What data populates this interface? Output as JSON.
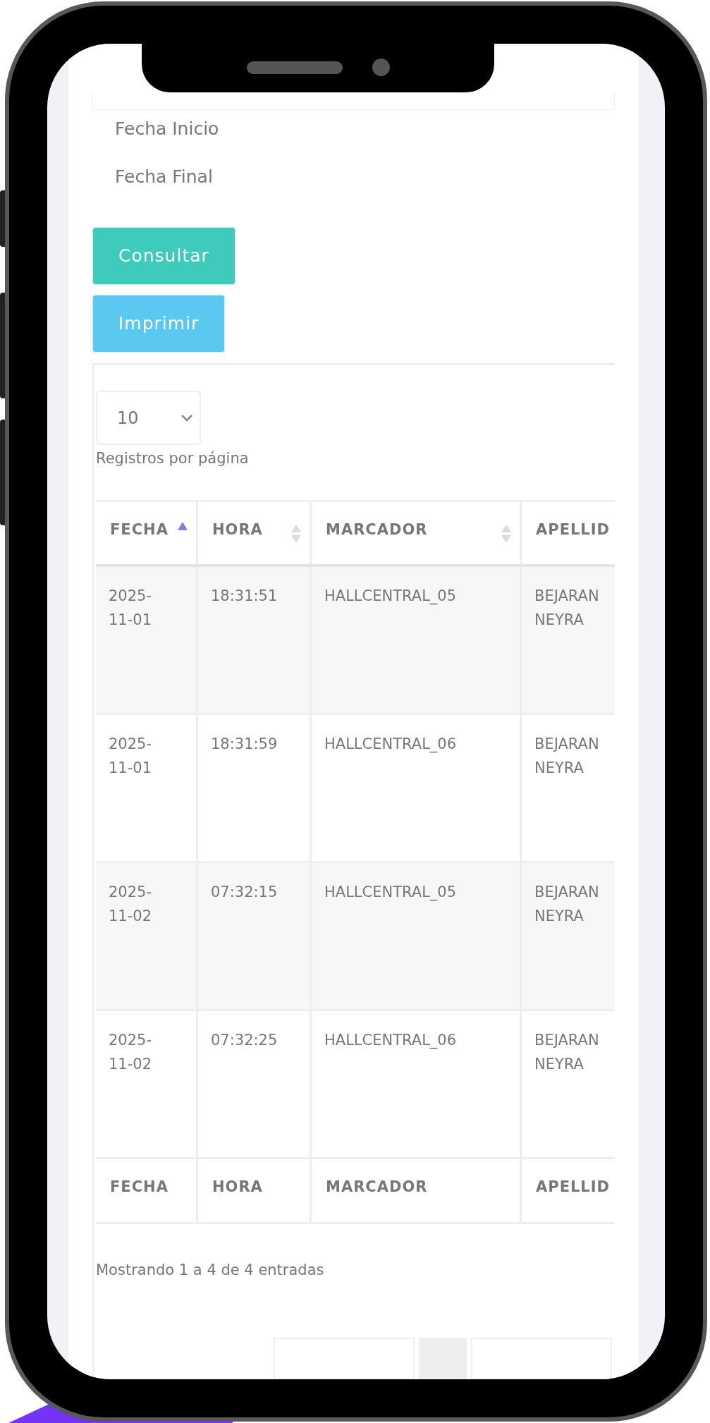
{
  "form": {
    "labels": [
      "Fecha Inicio",
      "Fecha Final"
    ],
    "buttons": [
      {
        "label": "Consultar",
        "kind": "primary"
      },
      {
        "label": "Imprimir",
        "kind": "info"
      }
    ]
  },
  "length_select": {
    "value": "10",
    "label": "Registros por página"
  },
  "table": {
    "columns": [
      {
        "label": "FECHA",
        "sorted": true
      },
      {
        "label": "HORA",
        "sorted": false
      },
      {
        "label": "MARCADOR",
        "sorted": false
      },
      {
        "label": "APELLID"
      }
    ],
    "rows": [
      [
        "2025-\n11-01",
        "18:31:51",
        "HALLCENTRAL_05",
        "BEJARAN\nNEYRA"
      ],
      [
        "2025-\n11-01",
        "18:31:59",
        "HALLCENTRAL_06",
        "BEJARAN\nNEYRA"
      ],
      [
        "2025-\n11-02",
        "07:32:15",
        "HALLCENTRAL_05",
        "BEJARAN\nNEYRA"
      ],
      [
        "2025-\n11-02",
        "07:32:25",
        "HALLCENTRAL_06",
        "BEJARAN\nNEYRA"
      ]
    ],
    "footer": [
      "FECHA",
      "HORA",
      "MARCADOR",
      "APELLID"
    ]
  },
  "info": "Mostrando 1 a 4 de 4 entradas",
  "pagination": [
    {
      "selected": false
    },
    {
      "selected": true
    },
    {
      "selected": false
    }
  ]
}
